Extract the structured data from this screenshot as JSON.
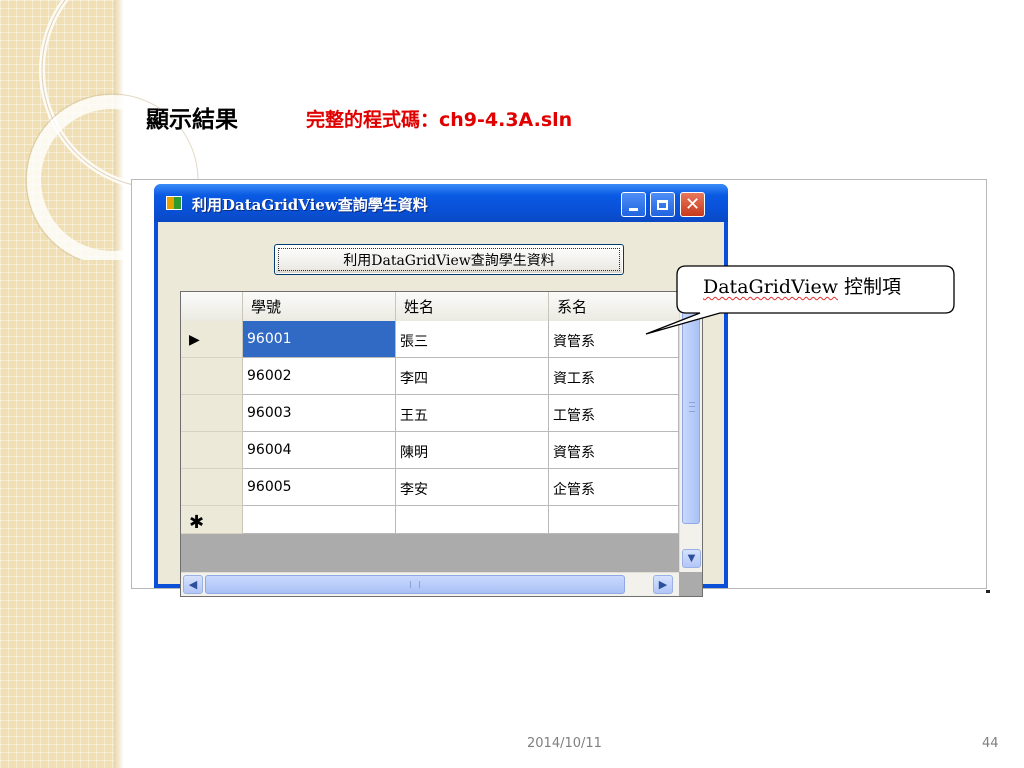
{
  "slide": {
    "title": "顯示結果",
    "subtitle": "完整的程式碼：ch9-4.3A.sln",
    "footer_date": "2014/10/11",
    "page_number": "44"
  },
  "window": {
    "title": "利用DataGridView查詢學生資料",
    "button_label": "利用DataGridView查詢學生資料",
    "controls": {
      "minimize": "minimize-icon",
      "maximize": "maximize-icon",
      "close": "✕"
    }
  },
  "grid": {
    "columns": [
      "學號",
      "姓名",
      "系名"
    ],
    "current_row_marker": "▶",
    "new_row_marker": "✱",
    "rows": [
      [
        "96001",
        "張三",
        "資管系"
      ],
      [
        "96002",
        "李四",
        "資工系"
      ],
      [
        "96003",
        "王五",
        "工管系"
      ],
      [
        "96004",
        "陳明",
        "資管系"
      ],
      [
        "96005",
        "李安",
        "企管系"
      ]
    ],
    "selected_row": 0,
    "selected_col": 0
  },
  "scroll": {
    "down_arrow": "▼",
    "left_arrow": "◀",
    "right_arrow": "▶"
  },
  "callout": {
    "text_latin": "DataGridView",
    "text_cjk": " 控制項"
  },
  "colors": {
    "title_red": "#e00000",
    "window_blue": "#0a4fd8",
    "selection": "#316ac5"
  }
}
